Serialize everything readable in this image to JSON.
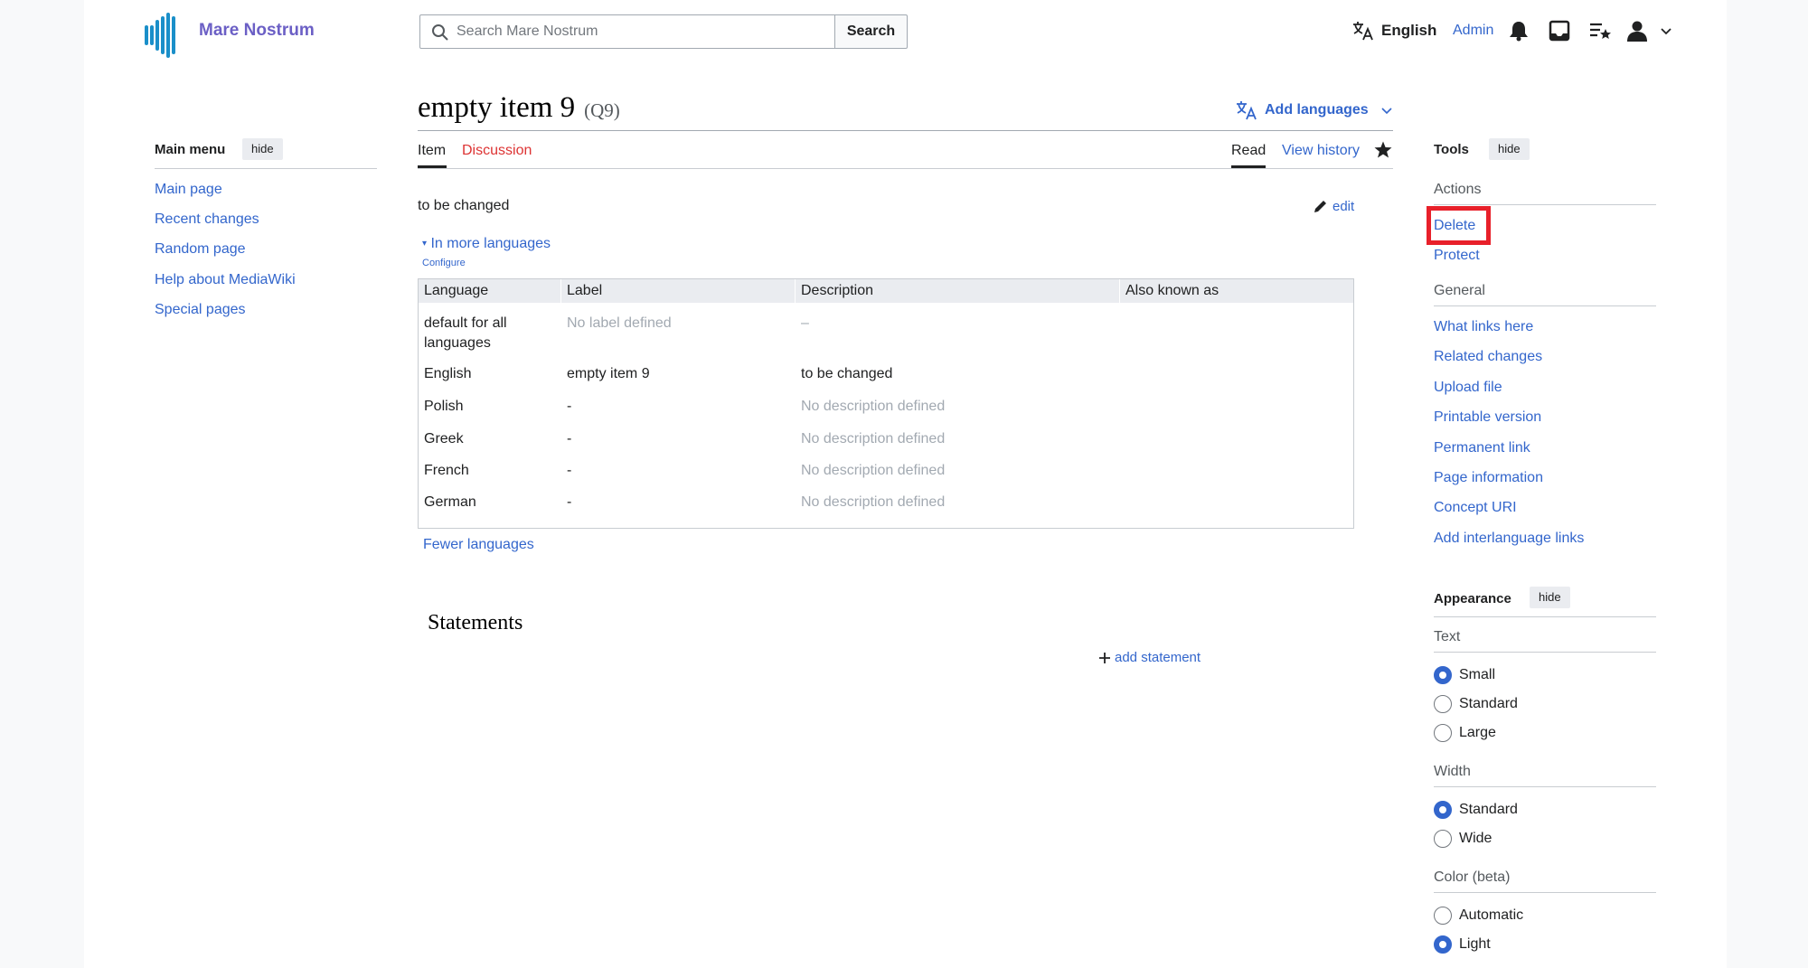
{
  "header": {
    "site_name": "Mare Nostrum",
    "search_placeholder": "Search Mare Nostrum",
    "search_button": "Search",
    "language_label": "English",
    "user_label": "Admin"
  },
  "page": {
    "title": "empty item 9",
    "qid": "(Q9)",
    "add_languages": "Add languages",
    "tabs_left": [
      "Item",
      "Discussion"
    ],
    "tabs_right": [
      "Read",
      "View history"
    ],
    "description": "to be changed",
    "edit_label": "edit",
    "in_more_languages": "In more languages",
    "configure": "Configure",
    "fewer_languages": "Fewer languages",
    "statements_heading": "Statements",
    "add_statement": "add statement"
  },
  "lang_table": {
    "headers": [
      "Language",
      "Label",
      "Description",
      "Also known as"
    ],
    "rows": [
      {
        "language": "default for all languages",
        "label": "No label defined",
        "description": "–"
      },
      {
        "language": "English",
        "label": "empty item 9",
        "description": "to be changed"
      },
      {
        "language": "Polish",
        "label": "-",
        "description": "No description defined"
      },
      {
        "language": "Greek",
        "label": "-",
        "description": "No description defined"
      },
      {
        "language": "French",
        "label": "-",
        "description": "No description defined"
      },
      {
        "language": "German",
        "label": "-",
        "description": "No description defined"
      }
    ]
  },
  "main_menu": {
    "heading": "Main menu",
    "hide": "hide",
    "items": [
      "Main page",
      "Recent changes",
      "Random page",
      "Help about MediaWiki",
      "Special pages"
    ]
  },
  "tools": {
    "heading": "Tools",
    "hide": "hide",
    "actions_heading": "Actions",
    "actions": [
      "Delete",
      "Protect"
    ],
    "general_heading": "General",
    "general": [
      "What links here",
      "Related changes",
      "Upload file",
      "Printable version",
      "Permanent link",
      "Page information",
      "Concept URI",
      "Add interlanguage links"
    ]
  },
  "appearance": {
    "heading": "Appearance",
    "hide": "hide",
    "text_heading": "Text",
    "text_options": [
      "Small",
      "Standard",
      "Large"
    ],
    "text_selected": "Small",
    "width_heading": "Width",
    "width_options": [
      "Standard",
      "Wide"
    ],
    "width_selected": "Standard",
    "color_heading": "Color (beta)",
    "color_options": [
      "Automatic",
      "Light"
    ],
    "color_selected": "Light"
  },
  "colors": {
    "link": "#3366cc",
    "highlight": "#e8202a",
    "discussion": "#d33",
    "brand": "#6b5fc5"
  }
}
